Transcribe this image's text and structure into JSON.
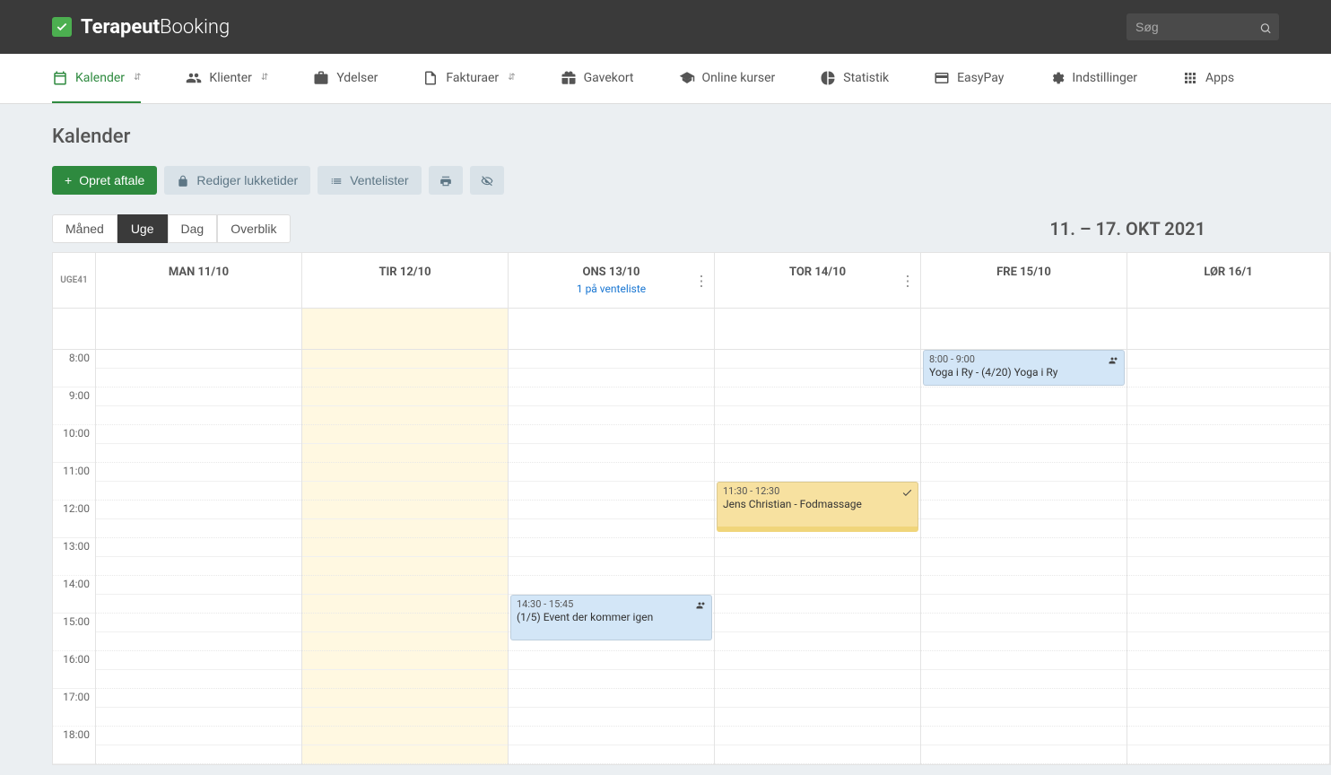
{
  "brand": {
    "part1": "Terapeut",
    "part2": "Booking"
  },
  "search": {
    "placeholder": "Søg"
  },
  "nav": {
    "kalender": "Kalender",
    "klienter": "Klienter",
    "ydelser": "Ydelser",
    "fakturaer": "Fakturaer",
    "gavekort": "Gavekort",
    "onlinekurser": "Online kurser",
    "statistik": "Statistik",
    "easypay": "EasyPay",
    "indstillinger": "Indstillinger",
    "apps": "Apps"
  },
  "page": {
    "title": "Kalender"
  },
  "toolbar": {
    "create": "Opret aftale",
    "closing": "Rediger lukketider",
    "waiting": "Ventelister"
  },
  "views": {
    "month": "Måned",
    "week": "Uge",
    "day": "Dag",
    "overview": "Overblik"
  },
  "dateRange": "11. – 17. OKT 2021",
  "weekLabel": "UGE41",
  "days": {
    "mon": "MAN 11/10",
    "tue": "TIR 12/10",
    "wed": "ONS 13/10",
    "wedSub": "1 på venteliste",
    "thu": "TOR 14/10",
    "fri": "FRE 15/10",
    "sat": "LØR 16/1"
  },
  "hours": {
    "h8": "8:00",
    "h9": "9:00",
    "h10": "10:00",
    "h11": "11:00",
    "h12": "12:00",
    "h13": "13:00",
    "h14": "14:00",
    "h15": "15:00",
    "h16": "16:00",
    "h17": "17:00",
    "h18": "18:00"
  },
  "events": {
    "e1": {
      "time": "8:00 - 9:00",
      "title": "Yoga i Ry - (4/20) Yoga i Ry"
    },
    "e2": {
      "time": "11:30 - 12:30",
      "title": "Jens Christian - Fodmassage"
    },
    "e3": {
      "time": "14:30 - 15:45",
      "title": "(1/5) Event der kommer igen"
    }
  }
}
